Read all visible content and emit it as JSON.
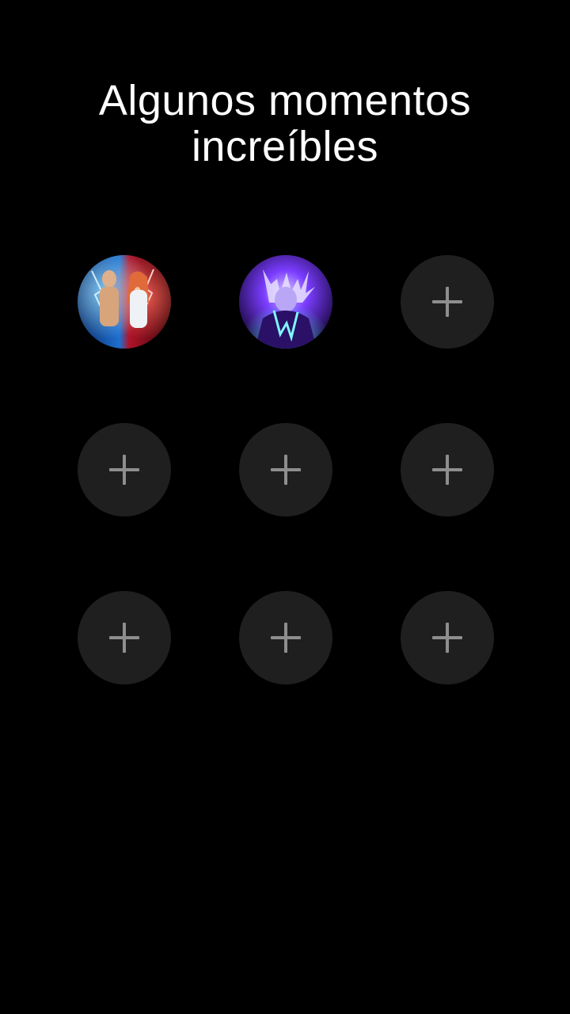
{
  "header": {
    "title_line1": "Algunos momentos",
    "title_line2": "increíbles"
  },
  "slots": [
    {
      "state": "filled",
      "image": "couple-lightning-thumbnail"
    },
    {
      "state": "filled",
      "image": "purple-anime-character-thumbnail"
    },
    {
      "state": "empty",
      "icon": "plus-icon"
    },
    {
      "state": "empty",
      "icon": "plus-icon"
    },
    {
      "state": "empty",
      "icon": "plus-icon"
    },
    {
      "state": "empty",
      "icon": "plus-icon"
    },
    {
      "state": "empty",
      "icon": "plus-icon"
    },
    {
      "state": "empty",
      "icon": "plus-icon"
    },
    {
      "state": "empty",
      "icon": "plus-icon"
    }
  ],
  "colors": {
    "background": "#000000",
    "slot": "#1f1f1f",
    "plus": "#8e8e8e",
    "text": "#ffffff"
  }
}
